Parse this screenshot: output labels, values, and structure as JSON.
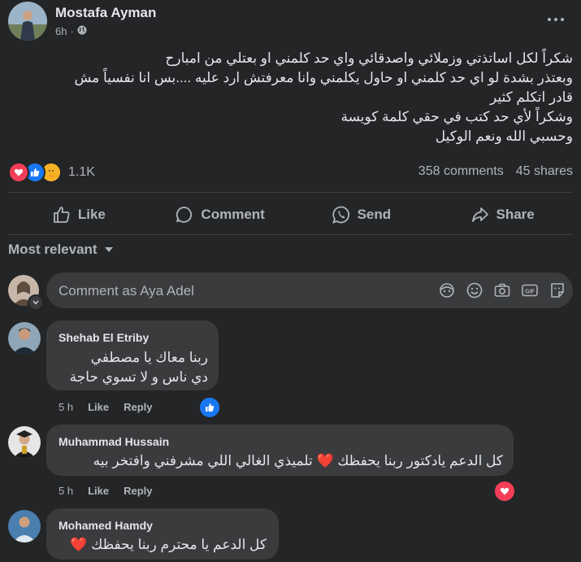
{
  "post": {
    "author": "Mostafa Ayman",
    "time": "6h",
    "separator": "·",
    "lines": [
      "شكراً لكل اساتذتي وزملائي واصدقائي واي حد كلمني او بعتلي من امبارح",
      "وبعتذر بشدة لو اي حد كلمني او حاول يكلمني وانا معرفتش ارد عليه ....بس انا نفسياً مش",
      "قادر اتكلم كثير",
      "وشكراً لأي حد كتب في حقي كلمة كويسة",
      "وحسبي الله ونعم الوكيل"
    ],
    "reaction_count": "1.1K",
    "comments_count": "358 comments",
    "shares_count": "45 shares"
  },
  "actions": {
    "like": "Like",
    "comment": "Comment",
    "send": "Send",
    "share": "Share"
  },
  "sort_label": "Most relevant",
  "composer": {
    "placeholder": "Comment as Aya Adel"
  },
  "comments": [
    {
      "name": "Shehab El Etriby",
      "lines": [
        "ربنا معاك يا مصطفي",
        "دي ناس و لا تسوي حاجة"
      ],
      "time": "5 h",
      "like": "Like",
      "reply": "Reply"
    },
    {
      "name": "Muhammad Hussain",
      "lines": [
        "كل الدعم يادكتور ربنا يحفظك ❤️ تلميذي الغالي اللي مشرفني وافتخر بيه"
      ],
      "time": "5 h",
      "like": "Like",
      "reply": "Reply"
    },
    {
      "name": "Mohamed Hamdy",
      "lines": [
        "كل الدعم يا محترم ربنا يحفظك ❤️"
      ]
    }
  ],
  "colors": {
    "background": "#242526",
    "bubble": "#3a3b3c",
    "like_blue": "#1877f2",
    "love_red": "#f33e58",
    "care_yellow": "#f7b125"
  }
}
